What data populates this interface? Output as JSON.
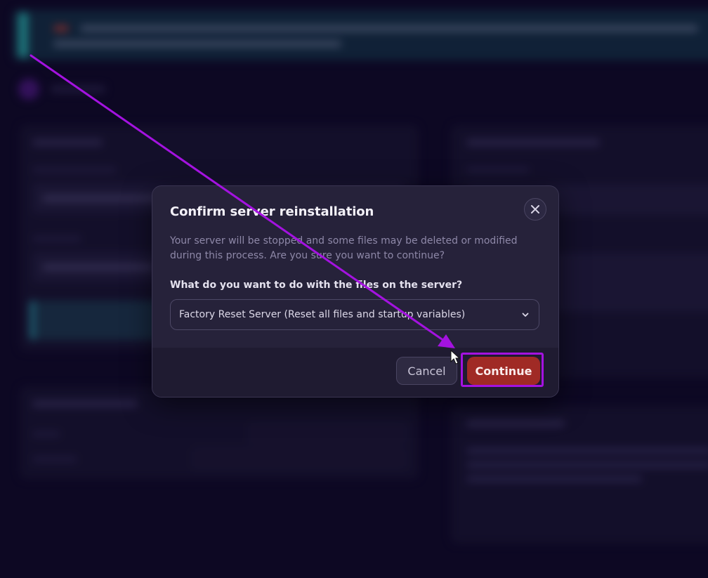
{
  "dialog": {
    "title": "Confirm server reinstallation",
    "description": "Your server will be stopped and some files may be deleted or modified during this process. Are you sure you want to continue?",
    "question_label": "What do you want to do with the files on the server?",
    "select": {
      "selected_value": "Factory Reset Server (Reset all files and startup variables)",
      "icon": "chevron-down-icon"
    },
    "close_icon": "close-icon",
    "cancel_label": "Cancel",
    "continue_label": "Continue"
  },
  "colors": {
    "background": "#110b2c",
    "modal_bg": "#26223a",
    "footer_bg": "#1f1b31",
    "continue_bg": "#a02a25",
    "annotation": "#a412e0",
    "banner_accent": "#2bb4b4"
  },
  "annotation": {
    "type": "arrow-and-highlight",
    "target": "continue-button",
    "color": "#a412e0"
  }
}
